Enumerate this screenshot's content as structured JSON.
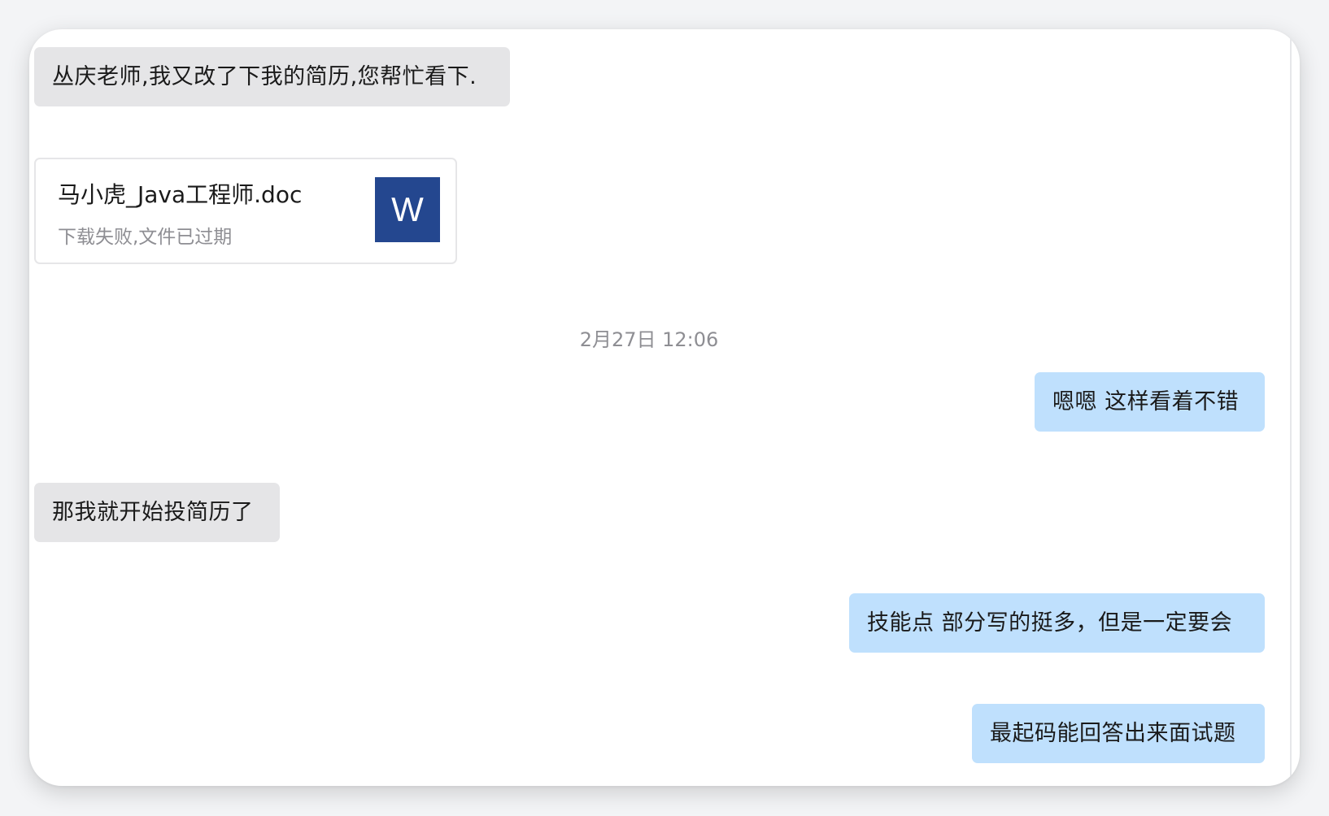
{
  "messages": [
    {
      "side": "left",
      "text": "丛庆老师,我又改了下我的简历,您帮忙看下."
    },
    {
      "side": "left",
      "file": {
        "name": "马小虎_Java工程师.doc",
        "status": "下载失败,文件已过期",
        "icon": "word-icon",
        "icon_letter": "W",
        "icon_color": "#24478f"
      }
    },
    {
      "side": "right",
      "text": "嗯嗯 这样看着不错"
    },
    {
      "side": "left",
      "text": "那我就开始投简历了"
    },
    {
      "side": "right",
      "text": "技能点 部分写的挺多，但是一定要会"
    },
    {
      "side": "right",
      "text": "最起码能回答出来面试题"
    }
  ],
  "timestamp": "2月27日 12:06",
  "colors": {
    "left_bubble": "#e5e5e7",
    "right_bubble": "#bfe0fd",
    "card_background": "#ffffff",
    "page_background": "#f3f4f6"
  }
}
